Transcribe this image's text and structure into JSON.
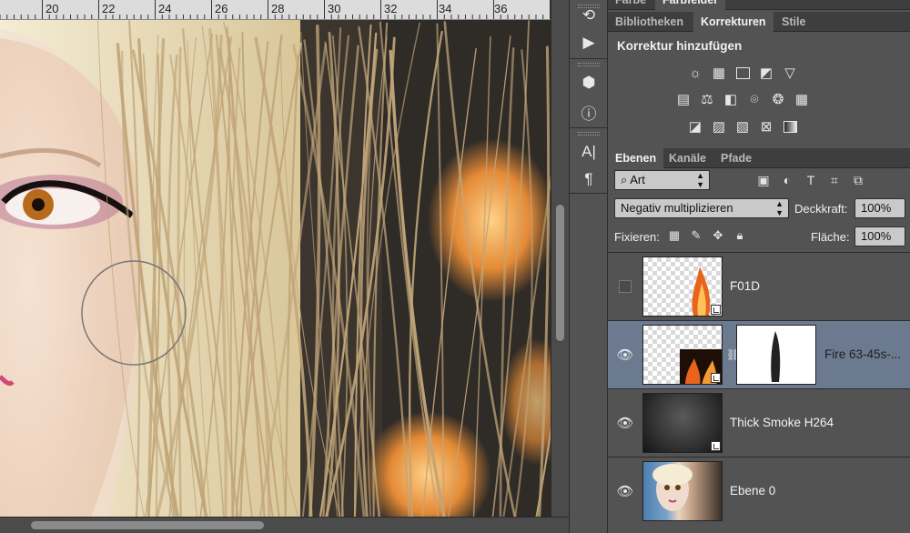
{
  "ruler": {
    "ticks": [
      "20",
      "22",
      "24",
      "26",
      "28",
      "30",
      "32",
      "34",
      "36"
    ]
  },
  "panel_top": {
    "tabs": [
      "Farbe",
      "Farbfelder"
    ],
    "active": 1
  },
  "corrections_panel": {
    "tabs": [
      "Bibliotheken",
      "Korrekturen",
      "Stile"
    ],
    "active": 1,
    "title": "Korrektur hinzufügen",
    "icons_row1": [
      "brightness-icon",
      "levels-icon",
      "curves-icon",
      "exposure-icon",
      "vibrance-icon"
    ],
    "icons_row2": [
      "hue-saturation-icon",
      "color-balance-icon",
      "black-white-icon",
      "photo-filter-icon",
      "channel-mixer-icon",
      "color-lookup-icon"
    ],
    "icons_row3": [
      "invert-icon",
      "posterize-icon",
      "threshold-icon",
      "selective-color-icon",
      "gradient-map-icon"
    ]
  },
  "layers_panel": {
    "tabs": [
      "Ebenen",
      "Kanäle",
      "Pfade"
    ],
    "active": 0,
    "filter_kind": "Art",
    "blend_mode": "Negativ multiplizieren",
    "opacity_label": "Deckkraft:",
    "opacity_value": "100%",
    "lock_label": "Fixieren:",
    "fill_label": "Fläche:",
    "fill_value": "100%",
    "layers": [
      {
        "name": "F01D",
        "visible": false,
        "selected": false
      },
      {
        "name": "Fire 63-45s-...",
        "visible": true,
        "selected": true
      },
      {
        "name": "Thick Smoke H264",
        "visible": true,
        "selected": false
      },
      {
        "name": "Ebene 0",
        "visible": true,
        "selected": false
      }
    ]
  },
  "colors": {
    "panel_bg": "#535353",
    "selected_layer": "#6c7a90",
    "tabbar_bg": "#3e3e3e"
  }
}
